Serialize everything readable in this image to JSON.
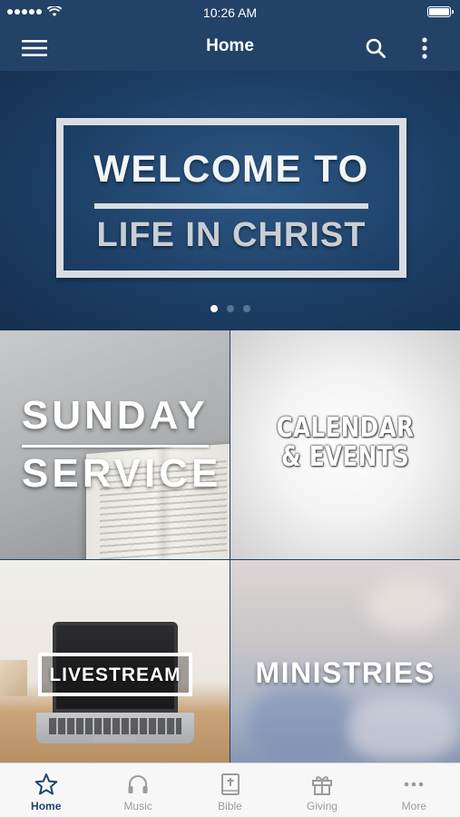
{
  "status_bar": {
    "time": "10:26 AM"
  },
  "nav": {
    "title": "Home"
  },
  "hero": {
    "line1": "WELCOME TO",
    "line2": "LIFE IN CHRIST",
    "page_count": 3,
    "active_page": 1
  },
  "tiles": {
    "sunday": {
      "line1": "SUNDAY",
      "line2": "SERVICE"
    },
    "calendar": {
      "line1": "CALENDAR",
      "line2": "& EVENTS"
    },
    "livestream": {
      "label": "LIVESTREAM"
    },
    "ministries": {
      "label": "MINISTRIES"
    }
  },
  "tab_bar": {
    "tabs": [
      {
        "label": "Home",
        "icon": "star-icon",
        "active": true
      },
      {
        "label": "Music",
        "icon": "headphones-icon",
        "active": false
      },
      {
        "label": "Bible",
        "icon": "bible-icon",
        "active": false
      },
      {
        "label": "Giving",
        "icon": "gift-icon",
        "active": false
      },
      {
        "label": "More",
        "icon": "more-horizontal-icon",
        "active": false
      }
    ]
  },
  "colors": {
    "brand_navy": "#224268",
    "tab_inactive": "#9b9b9b",
    "tab_active": "#224268"
  }
}
